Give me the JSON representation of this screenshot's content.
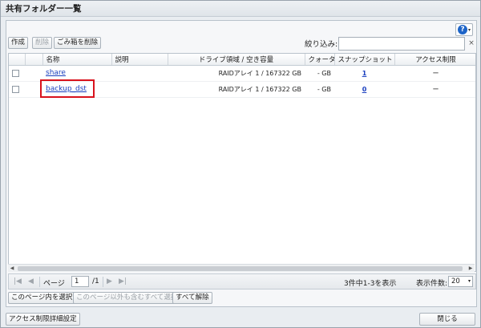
{
  "window": {
    "title": "共有フォルダー一覧"
  },
  "toolbar": {
    "create_label": "作成",
    "delete_label": "削除",
    "empty_trash_label": "ごみ箱を削除",
    "filter_label": "絞り込み:",
    "filter_value": "",
    "clear_glyph": "×",
    "help_glyph": "?",
    "help_dropdown_glyph": "▾"
  },
  "table": {
    "columns": [
      "名称",
      "説明",
      "ドライブ領域 / 空き容量",
      "クォータ",
      "スナップショット",
      "アクセス制限"
    ],
    "rows": [
      {
        "name": "share",
        "description": "",
        "drive": "RAIDアレイ 1 / 167322 GB",
        "quota": "- GB",
        "snapshot": "1",
        "access": "ー"
      },
      {
        "name": "backup_dst",
        "description": "",
        "drive": "RAIDアレイ 1 / 167322 GB",
        "quota": "- GB",
        "snapshot": "0",
        "access": "ー"
      }
    ]
  },
  "pager": {
    "first": "|◀",
    "prev": "◀",
    "page_label": "ページ",
    "page_value": "1",
    "total_pages": "/1",
    "next": "▶",
    "last": "▶|",
    "summary": "3件中1-3を表示",
    "per_page_label": "表示件数:",
    "per_page_value": "20",
    "dropdown_glyph": "▾"
  },
  "selection": {
    "select_page": "このページ内を選択",
    "select_all": "このページ以外も含むすべて選択",
    "clear_all": "すべて解除"
  },
  "footer": {
    "access_detail": "アクセス制限詳細設定",
    "close": "閉じる"
  },
  "scrollbar": {
    "left_arrow": "◀",
    "right_arrow": "▶"
  }
}
